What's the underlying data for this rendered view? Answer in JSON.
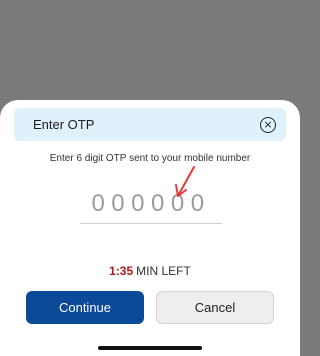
{
  "dialog": {
    "title": "Enter OTP",
    "close_icon": "close-circle-icon",
    "instruction": "Enter 6 digit OTP sent to your mobile number",
    "otp": {
      "value": "",
      "placeholder": "000000"
    },
    "annotation_icon": "red-arrow-icon",
    "timer": {
      "time": "1:35",
      "suffix": "MIN LEFT"
    },
    "buttons": {
      "continue": "Continue",
      "cancel": "Cancel"
    }
  },
  "colors": {
    "header_bg": "#dff1fb",
    "primary_button": "#0b4a98",
    "timer_red": "#b21b1b",
    "overlay": "#7a7a7a"
  }
}
